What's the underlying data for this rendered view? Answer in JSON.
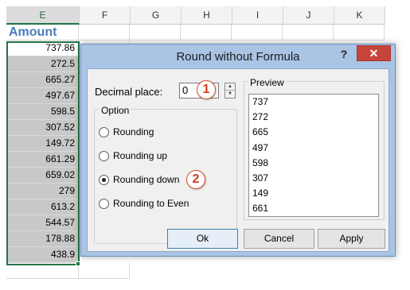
{
  "sheet": {
    "columns": [
      "E",
      "F",
      "G",
      "H",
      "I",
      "J",
      "K"
    ],
    "active_column": "E",
    "header_cell": "Amount",
    "values": [
      "737.86",
      "272.5",
      "665.27",
      "497.67",
      "598.5",
      "307.52",
      "149.72",
      "661.29",
      "659.02",
      "279",
      "613.2",
      "544.57",
      "178.88",
      "438.9"
    ]
  },
  "dialog": {
    "title": "Round without Formula",
    "help_label": "?",
    "close_label": "✕",
    "decimal_label": "Decimal place:",
    "decimal_value": "0",
    "option_legend": "Option",
    "options": [
      {
        "label": "Rounding",
        "checked": false
      },
      {
        "label": "Rounding up",
        "checked": false
      },
      {
        "label": "Rounding down",
        "checked": true
      },
      {
        "label": "Rounding to Even",
        "checked": false
      }
    ],
    "preview_legend": "Preview",
    "preview_items": [
      "737",
      "272",
      "665",
      "497",
      "598",
      "307",
      "149",
      "661"
    ],
    "ok_label": "Ok",
    "cancel_label": "Cancel",
    "apply_label": "Apply",
    "step_badges": [
      "1",
      "2"
    ],
    "spin_up_label": "▲",
    "spin_down_label": "▼"
  },
  "colors": {
    "accent_green": "#217346",
    "header_blue": "#4a7db8",
    "dialog_frame": "#a9c4e4",
    "close_red": "#c7443a",
    "badge_red": "#d13b1a"
  }
}
